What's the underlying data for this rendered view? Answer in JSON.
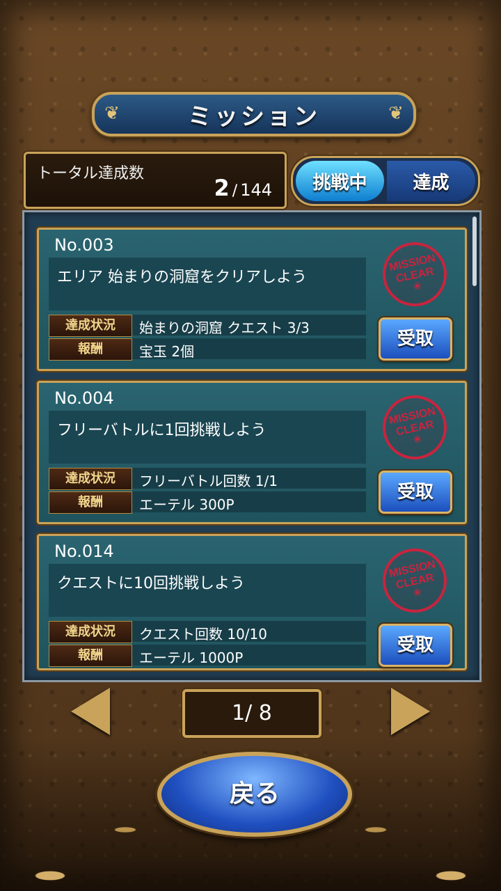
{
  "title": "ミッション",
  "total": {
    "label": "トータル達成数",
    "current": "2",
    "separator": "/",
    "max": "144"
  },
  "tabs": [
    {
      "label": "挑戦中",
      "active": true
    },
    {
      "label": "達成",
      "active": false
    }
  ],
  "status_label": "達成状況",
  "reward_label": "報酬",
  "stamp": {
    "line1": "MISSION",
    "line2": "CLEAR",
    "color": "#c8243e"
  },
  "claim_label": "受取",
  "missions": [
    {
      "no": "No.003",
      "title": "エリア 始まりの洞窟をクリアしよう",
      "status": "始まりの洞窟 クエスト 3/3",
      "reward": "宝玉 2個"
    },
    {
      "no": "No.004",
      "title": "フリーバトルに1回挑戦しよう",
      "status": "フリーバトル回数 1/1",
      "reward": "エーテル 300P"
    },
    {
      "no": "No.014",
      "title": "クエストに10回挑戦しよう",
      "status": "クエスト回数 10/10",
      "reward": "エーテル 1000P"
    }
  ],
  "pager": {
    "label": "1/ 8"
  },
  "back_label": "戻る"
}
